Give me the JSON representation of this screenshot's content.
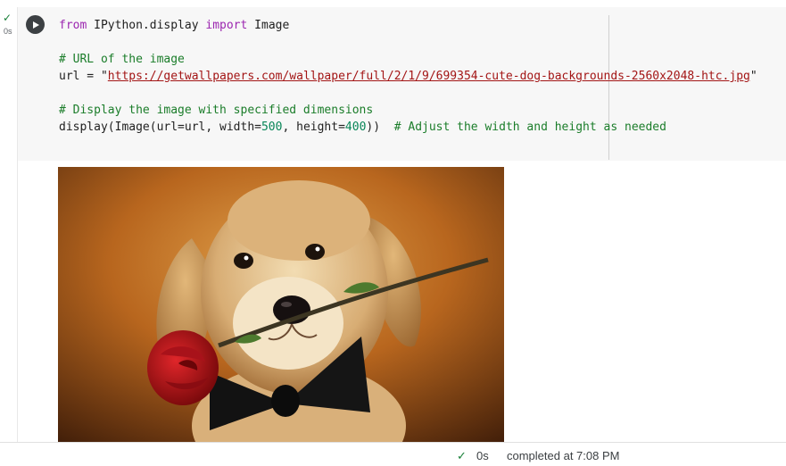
{
  "cell": {
    "exec_check": "✓",
    "exec_time": "0s",
    "code_lines": [
      [
        {
          "t": "from",
          "c": "kw"
        },
        {
          "t": " IPython.display "
        },
        {
          "t": "import",
          "c": "kw"
        },
        {
          "t": " Image"
        }
      ],
      [],
      [
        {
          "t": "# URL of the image",
          "c": "cm"
        }
      ],
      [
        {
          "t": "url = \""
        },
        {
          "t": "https://getwallpapers.com/wallpaper/full/2/1/9/699354-cute-dog-backgrounds-2560x2048-htc.jpg",
          "c": "str"
        },
        {
          "t": "\""
        }
      ],
      [],
      [
        {
          "t": "# Display the image with specified dimensions",
          "c": "cm"
        }
      ],
      [
        {
          "t": "display(Image(url=url, width="
        },
        {
          "t": "500",
          "c": "num"
        },
        {
          "t": ", height="
        },
        {
          "t": "400",
          "c": "num"
        },
        {
          "t": "))  "
        },
        {
          "t": "# Adjust the width and height as needed",
          "c": "cm"
        }
      ]
    ]
  },
  "output": {
    "image_icon": "puppy-with-rose-image"
  },
  "status": {
    "check": "✓",
    "duration": "0s",
    "text": "completed at 7:08 PM"
  },
  "colors": {
    "keyword": "#9c27b0",
    "comment": "#1b7d2a",
    "string": "#a31515",
    "number": "#098658",
    "success": "#188038"
  }
}
